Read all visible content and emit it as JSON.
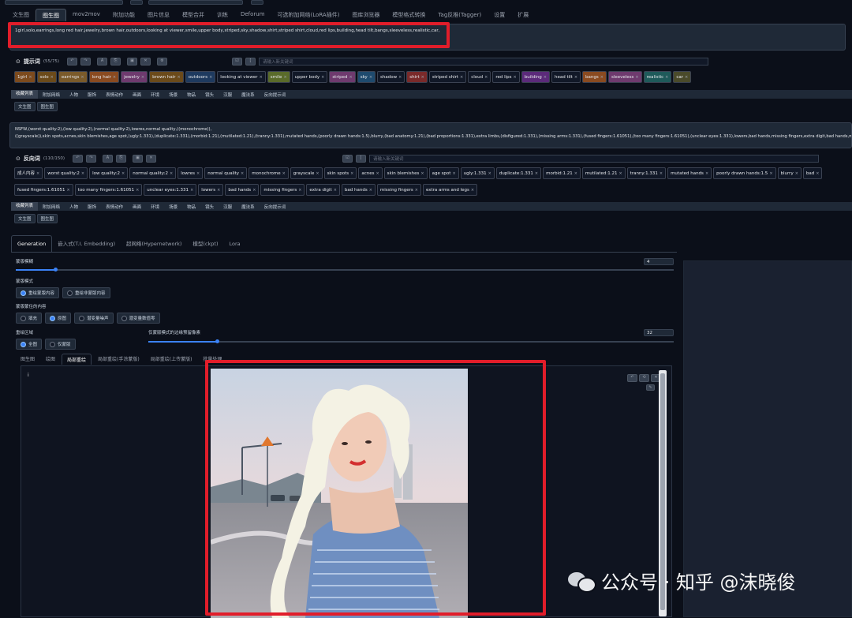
{
  "tabs": [
    "文生图",
    "图生图",
    "mov2mov",
    "附加功能",
    "图片信息",
    "模型合并",
    "训练",
    "Deforum",
    "可选附加网络(LoRA插件)",
    "图库浏览器",
    "模型格式转换",
    "Tag反推(Tagger)",
    "设置",
    "扩展"
  ],
  "active_tab": "图生图",
  "prompt": {
    "text": "1girl,solo,earrings,long red hair,jewelry,brown hair,outdoors,looking at viewer,smile,upper body,striped,sky,shadow,shirt,striped shirt,cloud,red lips,building,head tilt,bangs,sleeveless,realistic,car,",
    "header": "提示词",
    "count": "(55/75)",
    "search_placeholder": "请输入新关键词",
    "tags": [
      "1girl",
      "solo",
      "earrings",
      "long hair",
      "jewelry",
      "brown hair",
      "outdoors",
      "looking at viewer",
      "smile",
      "upper body",
      "striped",
      "sky",
      "shadow",
      "shirt",
      "striped shirt",
      "cloud",
      "red lips",
      "building",
      "head tilt",
      "bangs",
      "sleeveless",
      "realistic",
      "car"
    ]
  },
  "categories": [
    "收藏列表",
    "附加网络",
    "人物",
    "服饰",
    "表情动作",
    "画面",
    "环境",
    "场景",
    "物品",
    "镜头",
    "汉服",
    "魔法系",
    "反向提示词"
  ],
  "subtabs": [
    "文生图",
    "图生图"
  ],
  "negative": {
    "text1": "NSFW,(worst quality:2),(low quality:2),(normal quality:2),lowres,normal quality,((monochrome)),",
    "text2": "((grayscale)),skin spots,acnes,skin blemishes,age spot,(ugly:1.331),(duplicate:1.331),(morbid:1.21),(mutilated:1.21),(tranny:1.331),mutated hands,(poorly drawn hands:1.5),blurry,(bad anatomy:1.21),(bad proportions:1.331),extra limbs,(disfigured:1.331),(missing arms:1.331),(fused fingers:1.61051),(too many fingers:1.61051),(unclear eyes:1.331),lowers,bad hands,missing fingers,extra digit,bad hands,missing fingers,((extra arms and legs))",
    "header": "反向词",
    "count": "(110/150)",
    "search_placeholder": "请输入新关键词",
    "tags_row1": [
      "成人内容",
      "worst quality:2",
      "low quality:2",
      "normal quality:2",
      "lowres",
      "normal quality",
      "monochrome",
      "grayscale",
      "skin spots",
      "acnes",
      "skin blemishes",
      "age spot",
      "ugly:1.331",
      "duplicate:1.331",
      "morbid:1.21",
      "mutilated:1.21",
      "tranny:1.331",
      "mutated hands",
      "poorly drawn hands:1.5",
      "blurry",
      "bad"
    ],
    "tags_row2": [
      "fused fingers:1.61051",
      "too many fingers:1.61051",
      "unclear eyes:1.331",
      "lowers",
      "bad hands",
      "missing fingers",
      "extra digit",
      "bad hands",
      "missing fingers",
      "extra arms and legs"
    ]
  },
  "gen_tabs": [
    "Generation",
    "嵌入式(T.I. Embedding)",
    "超网络(Hypernetwork)",
    "模型(ckpt)",
    "Lora"
  ],
  "mask_blur": {
    "label": "蒙版模糊",
    "value": "4",
    "fraction": 0.06
  },
  "mask_mode": {
    "label": "蒙版模式",
    "options": [
      "重绘蒙版内容",
      "重绘非蒙版内容"
    ],
    "selected": 0
  },
  "masked_content": {
    "label": "蒙版蒙住的内容",
    "options": [
      "填充",
      "原图",
      "潜变量噪声",
      "潜变量数值零"
    ],
    "selected": 1
  },
  "inpaint_area": {
    "label": "重绘区域",
    "options": [
      "全图",
      "仅蒙版"
    ],
    "selected": 0
  },
  "padding": {
    "label": "仅蒙版模式的边缘预留像素",
    "value": "32",
    "fraction": 0.13
  },
  "img_tabs": [
    "图生图",
    "绘图",
    "局部重绘",
    "局部重绘(手涂蒙版)",
    "局部重绘(上传蒙版)",
    "批量处理"
  ],
  "img_active": "局部重绘",
  "watermark": "公众号 · 知乎 @沫晓俊",
  "colors": {
    "accent": "#3b82f6",
    "highlight": "#e11d2a"
  }
}
